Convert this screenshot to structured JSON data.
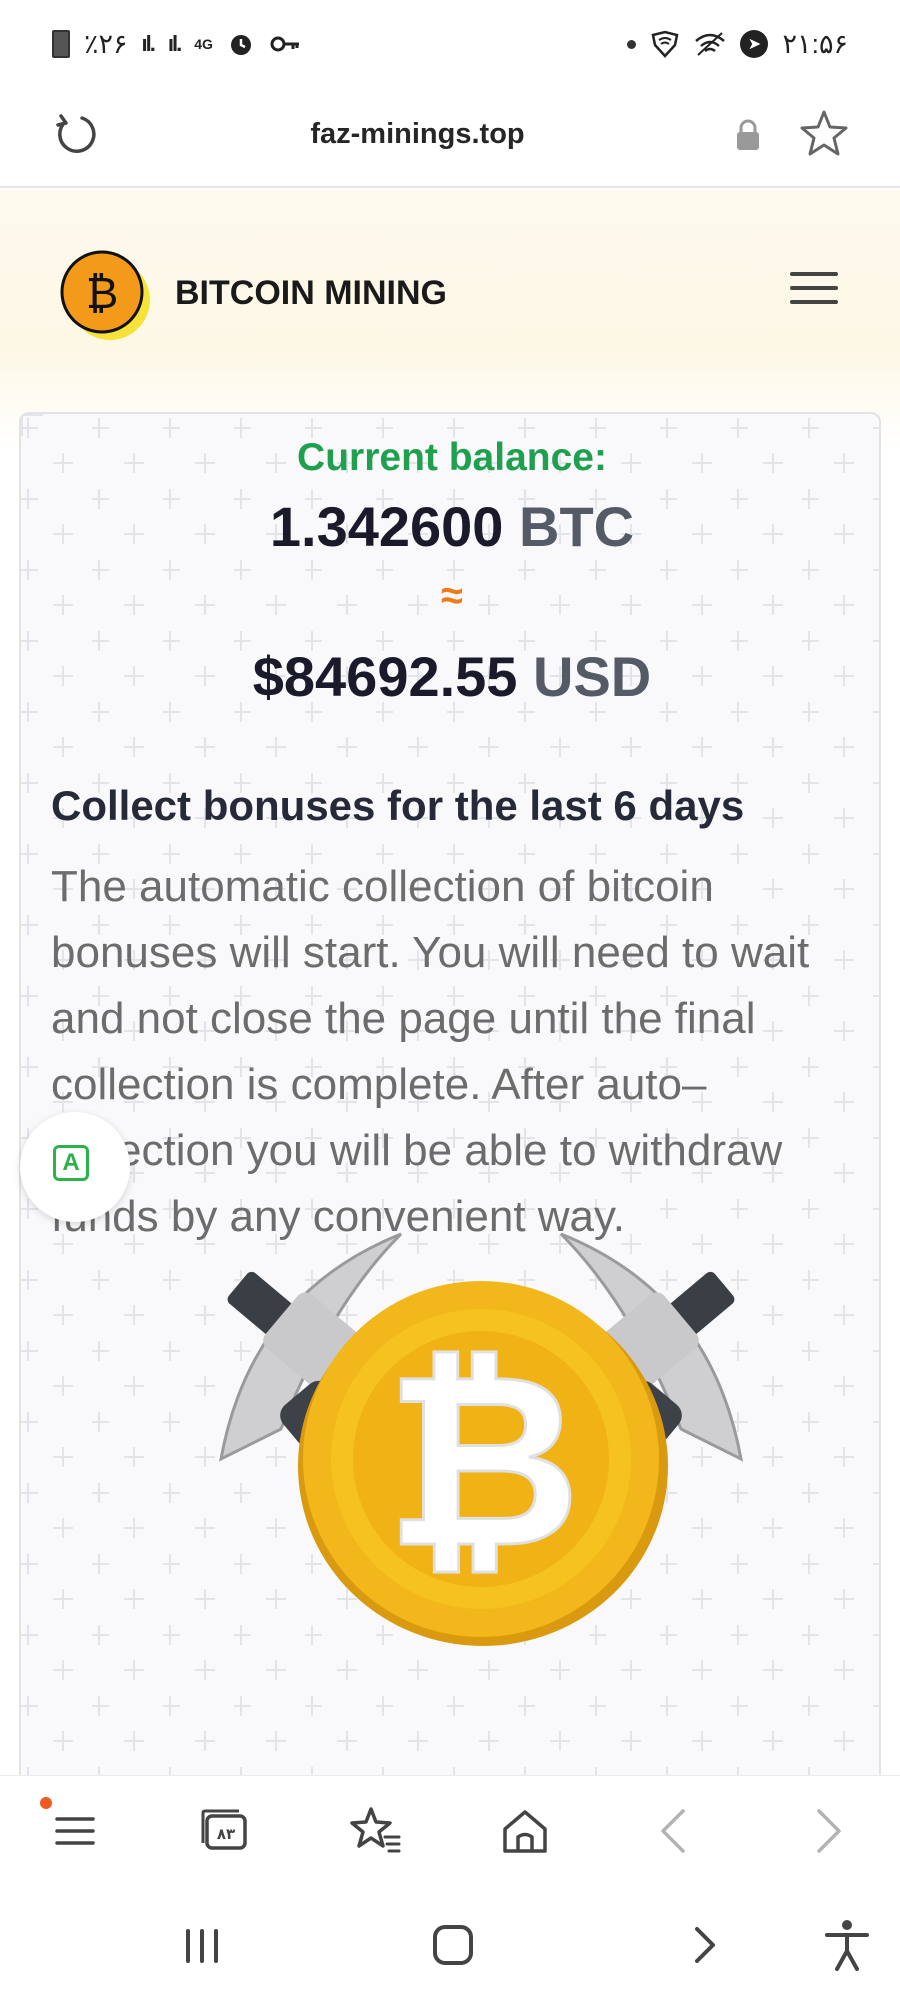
{
  "status_bar": {
    "battery_percent": "٪۲۶",
    "network": "4G",
    "time": "۲۱:۵۶"
  },
  "address_bar": {
    "url": "faz-minings.top"
  },
  "site_header": {
    "name": "BITCOIN MINING",
    "logo_icon": "bitcoin-logo-icon",
    "menu_icon": "hamburger-icon"
  },
  "balance": {
    "label": "Current balance:",
    "btc_amount": "1.342600",
    "btc_unit": "BTC",
    "approx_symbol": "≈",
    "usd_amount": "$84692.55",
    "usd_unit": "USD"
  },
  "bonus": {
    "title": "Collect bonuses for the last 6 days",
    "text": "The automatic collection of bitcoin bonuses will start. You will need to wait and not close the page until the final collection is complete. After auto–collection you will be able to withdraw funds by any convenient way."
  },
  "translate_button": {
    "glyph": "A"
  },
  "browser_toolbar": {
    "items": [
      {
        "icon": "menu-icon"
      },
      {
        "icon": "tabs-icon",
        "label": "۸۳"
      },
      {
        "icon": "bookmarks-icon"
      },
      {
        "icon": "home-icon"
      },
      {
        "icon": "back-icon"
      },
      {
        "icon": "forward-icon"
      }
    ]
  },
  "colors": {
    "balance_label": "#1ea04e",
    "approx": "#f07a16",
    "coin_gold": "#f2b71a",
    "translate_green": "#2bb24c"
  }
}
